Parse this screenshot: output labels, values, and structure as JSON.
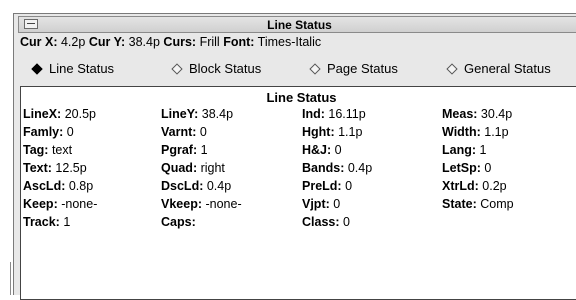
{
  "window": {
    "title": "Line Status"
  },
  "cursor_line": {
    "curx_label": "Cur X:",
    "curx_value": "4.2p",
    "cury_label": "Cur Y:",
    "cury_value": "38.4p",
    "curs_label": "Curs:",
    "curs_value": "Frill",
    "font_label": "Font:",
    "font_value": "Times-Italic"
  },
  "status_options": [
    {
      "label": "Line Status",
      "selected": true
    },
    {
      "label": "Block Status",
      "selected": false
    },
    {
      "label": "Page Status",
      "selected": false
    },
    {
      "label": "General Status",
      "selected": false
    }
  ],
  "panel": {
    "title": "Line Status",
    "rows": [
      [
        {
          "label": "LineX:",
          "value": "20.5p"
        },
        {
          "label": "LineY:",
          "value": "38.4p"
        },
        {
          "label": "Ind:",
          "value": "16.11p"
        },
        {
          "label": "Meas:",
          "value": "30.4p"
        }
      ],
      [
        {
          "label": "Famly:",
          "value": "0"
        },
        {
          "label": "Varnt:",
          "value": "0"
        },
        {
          "label": "Hght:",
          "value": "1.1p"
        },
        {
          "label": "Width:",
          "value": "1.1p"
        }
      ],
      [
        {
          "label": "Tag:",
          "value": "text"
        },
        {
          "label": "Pgraf:",
          "value": "1"
        },
        {
          "label": "H&J:",
          "value": "0"
        },
        {
          "label": "Lang:",
          "value": "1"
        }
      ],
      [
        {
          "label": "Text:",
          "value": "12.5p"
        },
        {
          "label": "Quad:",
          "value": "right"
        },
        {
          "label": "Bands:",
          "value": "0.4p"
        },
        {
          "label": "LetSp:",
          "value": "0"
        }
      ],
      [
        {
          "label": "AscLd:",
          "value": "0.8p"
        },
        {
          "label": "DscLd:",
          "value": "0.4p"
        },
        {
          "label": "PreLd:",
          "value": "0"
        },
        {
          "label": "XtrLd:",
          "value": "0.2p"
        }
      ],
      [
        {
          "label": "Keep:",
          "value": "-none-"
        },
        {
          "label": "Vkeep:",
          "value": "-none-"
        },
        {
          "label": "Vjpt:",
          "value": "0"
        },
        {
          "label": "State:",
          "value": "Comp"
        }
      ],
      [
        {
          "label": "Track:",
          "value": "1"
        },
        {
          "label": "Caps:",
          "value": ""
        },
        {
          "label": "Class:",
          "value": "0"
        },
        null
      ]
    ]
  }
}
